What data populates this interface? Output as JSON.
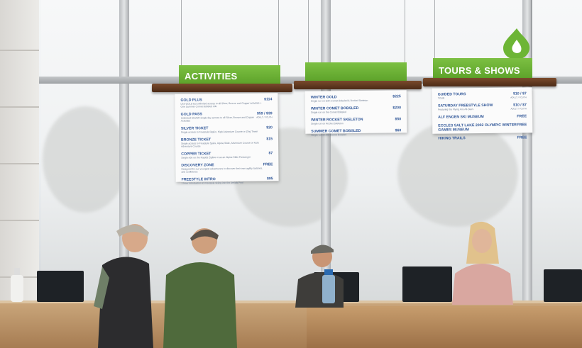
{
  "signs": {
    "activities": {
      "title": "ACTIVITIES",
      "items": [
        {
          "name": "GOLD PLUS",
          "desc": "Like GOLD but unlimited access to all Silver, Bronze and Copper activities + One Summer Comet Bobsled ride",
          "price": "$114",
          "price_note": ""
        },
        {
          "name": "GOLD PASS",
          "desc": "Unlimited SILVER single day access to all Silver, Bronze and Copper Activities",
          "price": "$59 / $39",
          "price_note": "ADULT / YOUTH"
        },
        {
          "name": "SILVER TICKET",
          "desc": "Single access to Freestyle Ripkin, High Adventure Course or Zing Tower",
          "price": "$20",
          "price_note": ""
        },
        {
          "name": "BRONZE TICKET",
          "desc": "Single access to Freestyle Spins, Alpine Slide, Adventure Course or Kid's Adventure Course",
          "price": "$15",
          "price_note": ""
        },
        {
          "name": "COPPER TICKET",
          "desc": "Single ride on the Rapids Zipline or as an Alpine Slide Passenger",
          "price": "$7",
          "price_note": ""
        },
        {
          "name": "DISCOVERY ZONE",
          "desc": "Designed for our youngest adventurers to discover their own agility, balance, and confidence",
          "price": "FREE",
          "price_note": ""
        },
        {
          "name": "FREESTYLE INTRO",
          "desc": "1 hour introduction to Freestyle skiing into the Aerials Pool",
          "price": "$95",
          "price_note": ""
        }
      ]
    },
    "winter": {
      "title": "",
      "items": [
        {
          "name": "WINTER GOLD",
          "desc": "Single run on both Comet Bobsled & Rocket Skeleton",
          "price": "$225",
          "price_note": ""
        },
        {
          "name": "WINTER COMET BOBSLED",
          "desc": "Single run on the Comet Bobsled",
          "price": "$200",
          "price_note": ""
        },
        {
          "name": "WINTER ROCKET SKELETON",
          "desc": "Single run on Rocket Skeleton",
          "price": "$50",
          "price_note": ""
        },
        {
          "name": "SUMMER COMET BOBSLED",
          "desc": "Single run on the Comet Bobsled",
          "price": "$60",
          "price_note": ""
        }
      ]
    },
    "tours": {
      "title": "TOURS & SHOWS",
      "items": [
        {
          "name": "GUIDED TOURS",
          "desc": "TOUR",
          "price": "$10 / $7",
          "price_note": "ADULT / YOUTH"
        },
        {
          "name": "SATURDAY FREESTYLE SHOW",
          "desc": "Featuring the Flying Ace All-Stars",
          "price": "$10 / $7",
          "price_note": "ADULT / YOUTH"
        },
        {
          "name": "ALF ENGEN SKI MUSEUM",
          "desc": "",
          "price": "FREE",
          "price_note": ""
        },
        {
          "name": "ECCLES SALT LAKE 2002 OLYMPIC WINTER GAMES MUSEUM",
          "desc": "",
          "price": "FREE",
          "price_note": ""
        },
        {
          "name": "HIKING TRAILS",
          "desc": "",
          "price": "FREE",
          "price_note": ""
        }
      ]
    }
  },
  "colors": {
    "accent_green": "#6db535",
    "menu_text": "#2e5597",
    "beam": "#5a3420"
  },
  "icons": [
    "drop-logo-icon"
  ]
}
